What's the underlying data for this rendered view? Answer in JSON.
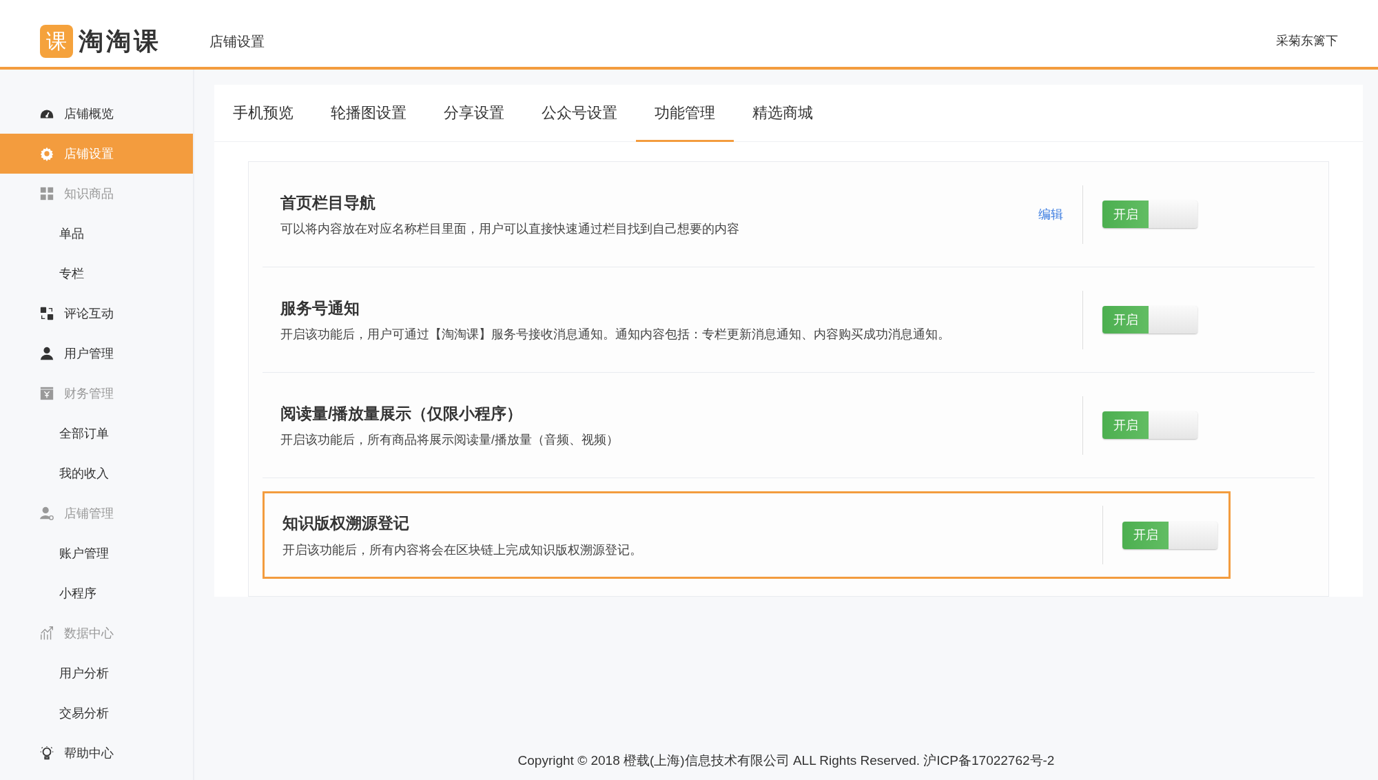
{
  "header": {
    "logo_mark": "课",
    "logo_name": "淘淘课",
    "page_title": "店铺设置",
    "user": "采菊东篱下"
  },
  "sidebar": {
    "items": [
      {
        "kind": "link",
        "label": "店铺概览",
        "selected": false
      },
      {
        "kind": "link",
        "label": "店铺设置",
        "selected": true
      },
      {
        "kind": "group",
        "label": "知识商品",
        "selected": false
      },
      {
        "kind": "sub",
        "label": "单品",
        "selected": false
      },
      {
        "kind": "sub",
        "label": "专栏",
        "selected": false
      },
      {
        "kind": "link",
        "label": "评论互动",
        "selected": false
      },
      {
        "kind": "link",
        "label": "用户管理",
        "selected": false
      },
      {
        "kind": "group",
        "label": "财务管理",
        "selected": false
      },
      {
        "kind": "sub",
        "label": "全部订单",
        "selected": false
      },
      {
        "kind": "sub",
        "label": "我的收入",
        "selected": false
      },
      {
        "kind": "group",
        "label": "店铺管理",
        "selected": false
      },
      {
        "kind": "sub",
        "label": "账户管理",
        "selected": false
      },
      {
        "kind": "sub",
        "label": "小程序",
        "selected": false
      },
      {
        "kind": "group",
        "label": "数据中心",
        "selected": false
      },
      {
        "kind": "sub",
        "label": "用户分析",
        "selected": false
      },
      {
        "kind": "sub",
        "label": "交易分析",
        "selected": false
      },
      {
        "kind": "link",
        "label": "帮助中心",
        "selected": false
      }
    ]
  },
  "tabs": [
    {
      "label": "手机预览",
      "selected": false
    },
    {
      "label": "轮播图设置",
      "selected": false
    },
    {
      "label": "分享设置",
      "selected": false
    },
    {
      "label": "公众号设置",
      "selected": false
    },
    {
      "label": "功能管理",
      "selected": true
    },
    {
      "label": "精选商城",
      "selected": false
    }
  ],
  "features": [
    {
      "title": "首页栏目导航",
      "description": "可以将内容放在对应名称栏目里面，用户可以直接快速通过栏目找到自己想要的内容",
      "edit_link": "编辑",
      "switch_label": "开启",
      "on": true,
      "highlighted": false
    },
    {
      "title": "服务号通知",
      "description": "开启该功能后，用户可通过【淘淘课】服务号接收消息通知。通知内容包括：专栏更新消息通知、内容购买成功消息通知。",
      "switch_label": "开启",
      "on": true,
      "highlighted": false
    },
    {
      "title": "阅读量/播放量展示（仅限小程序）",
      "description": "开启该功能后，所有商品将展示阅读量/播放量（音频、视频）",
      "switch_label": "开启",
      "on": true,
      "highlighted": false
    },
    {
      "title": "知识版权溯源登记",
      "description": "开启该功能后，所有内容将会在区块链上完成知识版权溯源登记。",
      "switch_label": "开启",
      "on": true,
      "highlighted": true
    }
  ],
  "footer": "Copyright © 2018 橙载(上海)信息技术有限公司 ALL Rights Reserved. 沪ICP备17022762号-2"
}
